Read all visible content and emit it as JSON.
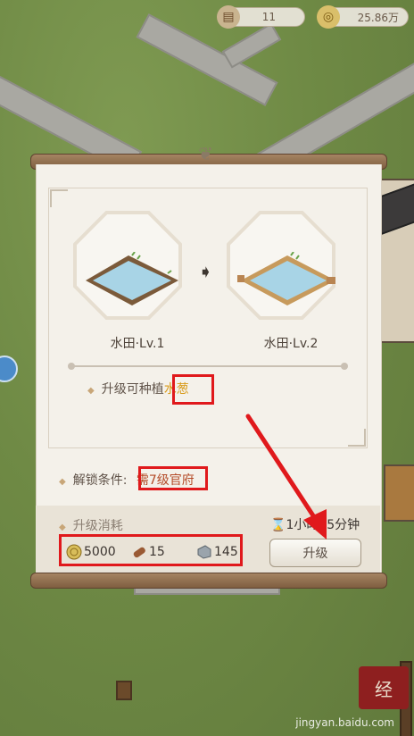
{
  "hud": {
    "resource_count": "11",
    "coins": "25.86万"
  },
  "panel": {
    "current": {
      "label": "水田·Lv.1"
    },
    "next": {
      "label": "水田·Lv.2"
    },
    "unlock_crop_prefix": "升级可种植",
    "unlock_crop_name": "水葱",
    "condition_label": "解锁条件:",
    "condition_value": "需7级官府",
    "cost_title": "升级消耗",
    "costs": [
      {
        "icon": "coin-icon",
        "amount": "5000"
      },
      {
        "icon": "wood-icon",
        "amount": "15"
      },
      {
        "icon": "stone-icon",
        "amount": "145"
      }
    ],
    "timer": "1小时15分钟",
    "upgrade_label": "升级"
  },
  "bubble_text": "",
  "watermark": {
    "logo_text": "经",
    "text": "jingyan.baidu.com"
  },
  "colors": {
    "grass": "#6f8a45",
    "panel_bg": "#f4f1ea",
    "crop_highlight": "#d89a19",
    "annotation_red": "#e0191c"
  }
}
